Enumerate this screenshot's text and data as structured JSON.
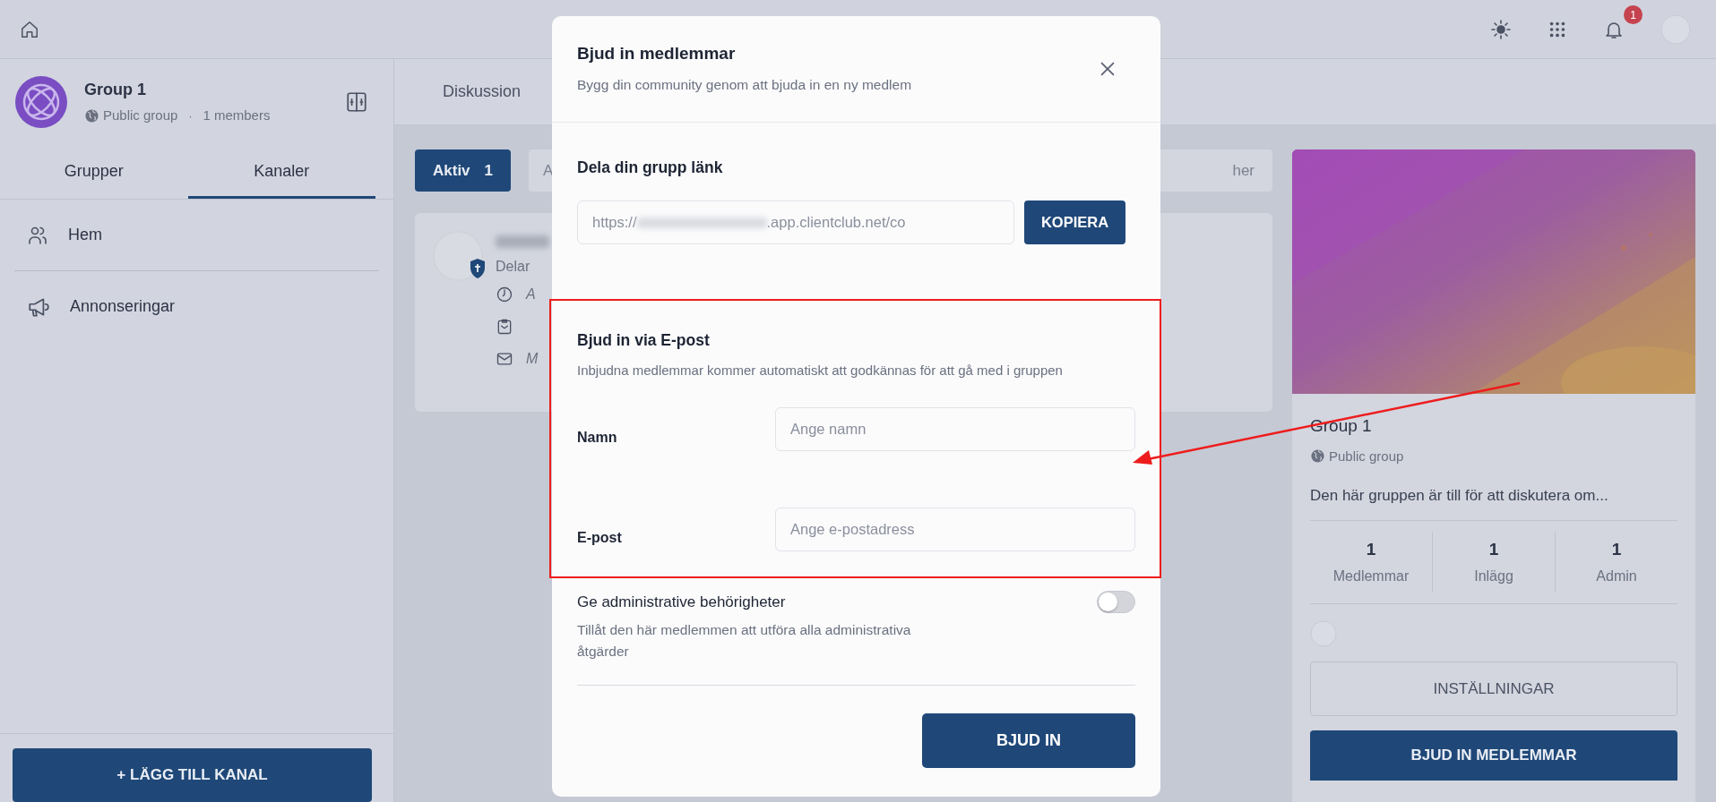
{
  "topbar": {
    "notification_count": "1"
  },
  "sidebar": {
    "group": {
      "name": "Group 1",
      "privacy": "Public group",
      "separator": "·",
      "members": "1 members"
    },
    "tabs": [
      {
        "label": "Grupper",
        "selected": false
      },
      {
        "label": "Kanaler",
        "selected": true
      }
    ],
    "channels": [
      {
        "kind": "people",
        "label": "Hem"
      },
      {
        "kind": "megaphone",
        "label": "Annonseringar"
      }
    ],
    "add_button": "+ LÄGG TILL KANAL"
  },
  "main": {
    "tabs": [
      {
        "label": "Diskussion"
      }
    ],
    "filters": {
      "active_label": "Aktiv",
      "active_count": "1",
      "search_start": "A",
      "search_end": "her"
    },
    "post": {
      "subtitle": "Delar",
      "details": [
        {
          "kind": "clock",
          "text": "A"
        },
        {
          "kind": "clipboard"
        },
        {
          "kind": "mail",
          "text": "M"
        }
      ]
    }
  },
  "group_card": {
    "name": "Group 1",
    "privacy": "Public group",
    "description": "Den här gruppen är till för att diskutera om...",
    "stats": [
      {
        "value": "1",
        "label": "Medlemmar"
      },
      {
        "value": "1",
        "label": "Inlägg"
      },
      {
        "value": "1",
        "label": "Admin"
      }
    ],
    "settings_button": "INSTÄLLNINGAR",
    "invite_button": "BJUD IN MEDLEMMAR"
  },
  "modal": {
    "title": "Bjud in medlemmar",
    "subtitle": "Bygg din community genom att bjuda in en ny medlem",
    "share": {
      "heading": "Dela din grupp länk",
      "url_start": "https://",
      "url_end": ".app.clientclub.net/co",
      "copy_button": "KOPIERA"
    },
    "email": {
      "heading": "Bjud in via E-post",
      "description": "Inbjudna medlemmar kommer automatiskt att godkännas för att gå med i gruppen",
      "fields": [
        {
          "label": "Namn",
          "placeholder": "Ange namn"
        },
        {
          "label": "E-post",
          "placeholder": "Ange e-postadress"
        }
      ]
    },
    "admin": {
      "title": "Ge administrative behörigheter",
      "description": "Tillåt den här medlemmen att utföra alla administrativa åtgärder",
      "on": false
    },
    "submit_button": "BJUD IN"
  },
  "annotations": {
    "highlight_box": true,
    "arrow": true
  }
}
